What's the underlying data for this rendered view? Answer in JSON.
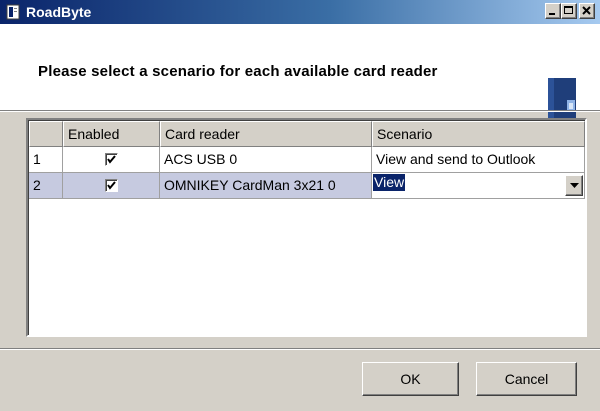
{
  "window": {
    "title": "RoadByte",
    "icon": "app-document-icon"
  },
  "header": {
    "instruction": "Please select a scenario for each available card reader",
    "icon": "card-reader-icon"
  },
  "grid": {
    "columns": [
      "",
      "Enabled",
      "Card reader",
      "Scenario"
    ],
    "rows": [
      {
        "index": "1",
        "enabled": true,
        "card_reader": "ACS USB 0",
        "scenario": "View and send to Outlook"
      },
      {
        "index": "2",
        "enabled": true,
        "card_reader": "OMNIKEY CardMan 3x21 0",
        "scenario": "View"
      }
    ]
  },
  "buttons": {
    "ok": "OK",
    "cancel": "Cancel"
  },
  "colors": {
    "title_bar_start": "#0a246a",
    "title_bar_end": "#a6caf0",
    "selection": "#0a246a",
    "row_highlight": "#c6cae0",
    "face": "#d4d0c8"
  }
}
